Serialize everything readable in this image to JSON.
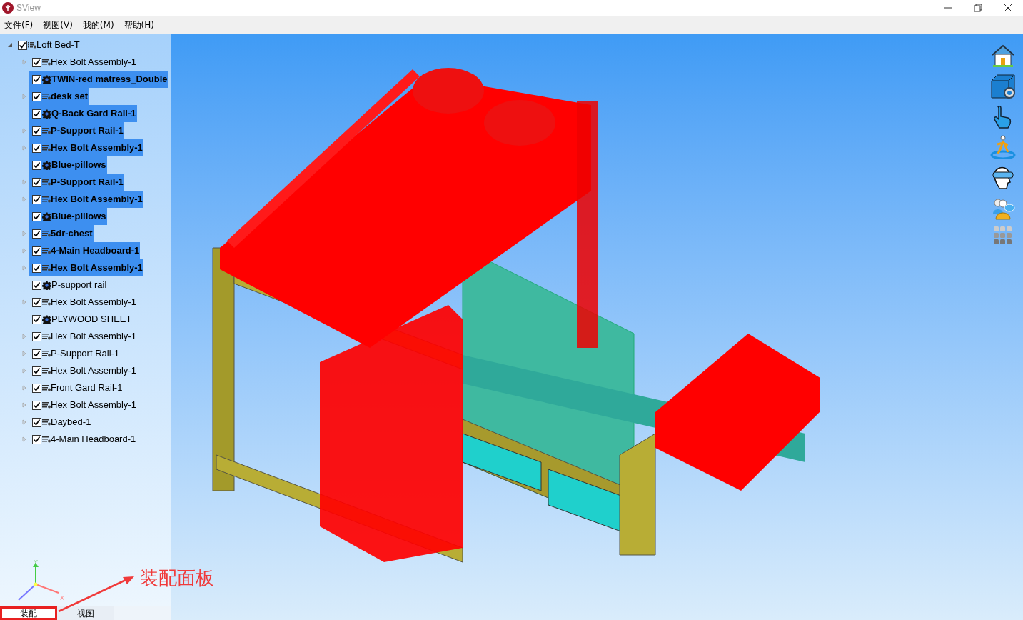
{
  "window": {
    "title": "SView"
  },
  "menu": [
    "文件(F)",
    "视图(V)",
    "我的(M)",
    "帮助(H)"
  ],
  "tree": {
    "label": "Loft Bed-T",
    "kind": "assembly",
    "checked": true,
    "expanded": true,
    "selected": false,
    "children": [
      {
        "label": "Hex Bolt Assembly-1",
        "kind": "assembly",
        "checked": true,
        "selected": false
      },
      {
        "label": "TWIN-red matress_Double",
        "kind": "part",
        "checked": true,
        "selected": true
      },
      {
        "label": "desk set",
        "kind": "assembly",
        "checked": true,
        "selected": true
      },
      {
        "label": "Q-Back Gard Rail-1",
        "kind": "part",
        "checked": true,
        "selected": true
      },
      {
        "label": "P-Support Rail-1",
        "kind": "assembly",
        "checked": true,
        "selected": true
      },
      {
        "label": "Hex Bolt Assembly-1",
        "kind": "assembly",
        "checked": true,
        "selected": true
      },
      {
        "label": "Blue-pillows",
        "kind": "part",
        "checked": true,
        "selected": true
      },
      {
        "label": "P-Support Rail-1",
        "kind": "assembly",
        "checked": true,
        "selected": true
      },
      {
        "label": "Hex Bolt Assembly-1",
        "kind": "assembly",
        "checked": true,
        "selected": true
      },
      {
        "label": "Blue-pillows",
        "kind": "part",
        "checked": true,
        "selected": true
      },
      {
        "label": "5dr-chest",
        "kind": "assembly",
        "checked": true,
        "selected": true
      },
      {
        "label": "4-Main Headboard-1",
        "kind": "assembly",
        "checked": true,
        "selected": true
      },
      {
        "label": "Hex Bolt Assembly-1",
        "kind": "assembly",
        "checked": true,
        "selected": true
      },
      {
        "label": "P-support rail",
        "kind": "part",
        "checked": true,
        "selected": false
      },
      {
        "label": "Hex Bolt Assembly-1",
        "kind": "assembly",
        "checked": true,
        "selected": false
      },
      {
        "label": "PLYWOOD SHEET",
        "kind": "part",
        "checked": true,
        "selected": false
      },
      {
        "label": "Hex Bolt Assembly-1",
        "kind": "assembly",
        "checked": true,
        "selected": false
      },
      {
        "label": "P-Support Rail-1",
        "kind": "assembly",
        "checked": true,
        "selected": false
      },
      {
        "label": "Hex Bolt Assembly-1",
        "kind": "assembly",
        "checked": true,
        "selected": false
      },
      {
        "label": "Front Gard Rail-1",
        "kind": "assembly",
        "checked": true,
        "selected": false
      },
      {
        "label": "Hex Bolt Assembly-1",
        "kind": "assembly",
        "checked": true,
        "selected": false
      },
      {
        "label": "Daybed-1",
        "kind": "assembly",
        "checked": true,
        "selected": false
      },
      {
        "label": "4-Main Headboard-1",
        "kind": "assembly",
        "checked": true,
        "selected": false
      }
    ]
  },
  "axes": {
    "y": "Y",
    "x": "X"
  },
  "panel_tabs": [
    {
      "label": "装配",
      "selected": true
    },
    {
      "label": "视图",
      "selected": false
    }
  ],
  "annotation": {
    "text": "装配面板"
  }
}
